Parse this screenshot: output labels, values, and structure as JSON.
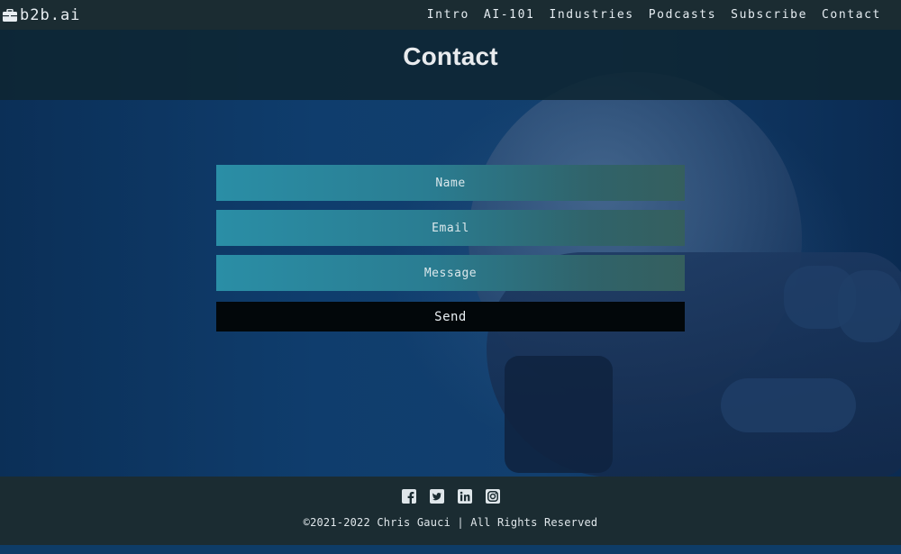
{
  "brand": {
    "name": "b2b.ai",
    "icon": "briefcase-icon"
  },
  "nav": {
    "items": [
      {
        "label": "Intro"
      },
      {
        "label": "AI-101"
      },
      {
        "label": "Industries"
      },
      {
        "label": "Podcasts"
      },
      {
        "label": "Subscribe"
      },
      {
        "label": "Contact"
      }
    ]
  },
  "header": {
    "title": "Contact"
  },
  "form": {
    "name_placeholder": "Name",
    "name_value": "",
    "email_placeholder": "Email",
    "email_value": "",
    "message_placeholder": "Message",
    "message_value": "",
    "send_label": "Send"
  },
  "footer": {
    "social": [
      {
        "icon": "facebook-icon"
      },
      {
        "icon": "twitter-icon"
      },
      {
        "icon": "linkedin-icon"
      },
      {
        "icon": "instagram-icon"
      }
    ],
    "copyright": "©2021-2022 Chris Gauci | All Rights Reserved"
  },
  "colors": {
    "bar": "#1b2c32",
    "field_start": "#2a8ea6",
    "field_end": "#355f5e",
    "button": "#02070a",
    "background": "#0f3d6d"
  }
}
